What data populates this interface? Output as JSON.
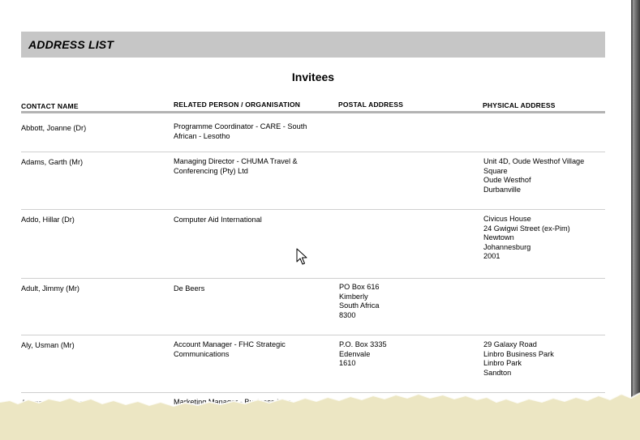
{
  "report": {
    "section_title": "ADDRESS LIST",
    "subtitle": "Invitees",
    "columns": {
      "contact": "CONTACT NAME",
      "related": "RELATED PERSON / ORGANISATION",
      "postal": "POSTAL ADDRESS",
      "physical": "PHYSICAL ADDRESS"
    },
    "rows": [
      {
        "name": "Abbott, Joanne   (Dr)",
        "related": "Programme Coordinator - CARE - South\nAfrican - Lesotho",
        "postal": "",
        "physical": ""
      },
      {
        "name": "Adams, Garth   (Mr)",
        "related": "Managing Director - CHUMA Travel &\nConferencing (Pty) Ltd",
        "postal": "",
        "physical": "Unit 4D, Oude Westhof Village\nSquare\nOude Westhof\nDurbanville"
      },
      {
        "name": "Addo, Hillar   (Dr)",
        "related": "Computer Aid International",
        "postal": "",
        "physical": "Civicus House\n24 Gwigwi Street (ex-Pim)\nNewtown\nJohannesburg\n2001"
      },
      {
        "name": "Adult, Jimmy   (Mr)",
        "related": "De Beers",
        "postal": "PO Box 616\nKimberly\nSouth Africa\n8300",
        "physical": ""
      },
      {
        "name": "Aly, Usman   (Mr)",
        "related": "Account Manager - FHC Strategic\nCommunications",
        "postal": "P.O. Box 3335\nEdenvale\n1610",
        "physical": "29 Galaxy Road\nLinbro Business Park\nLinbro Park\nSandton"
      },
      {
        "name": "Ananasalay, Saresa",
        "related": "Marketing Manager - Business Map",
        "postal": "",
        "physical": ""
      }
    ]
  },
  "icons": {
    "cursor": "mouse-pointer-icon",
    "torn_edge": "torn-paper-edge"
  },
  "colors": {
    "header_bar": "#c6c6c6",
    "torn_paper": "#ece6c3"
  }
}
